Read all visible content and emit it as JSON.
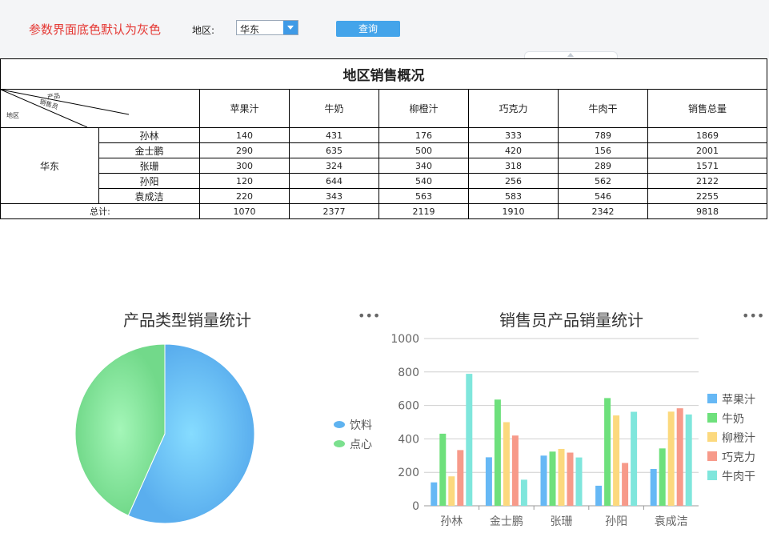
{
  "param_bar": {
    "hint": "参数界面底色默认为灰色",
    "region_label": "地区:",
    "region_value": "华东",
    "query_label": "查询"
  },
  "report": {
    "title": "地区销售概况",
    "corner": {
      "product": "产品",
      "seller": "销售员",
      "region": "地区"
    },
    "columns": [
      "苹果汁",
      "牛奶",
      "柳橙汁",
      "巧克力",
      "牛肉干",
      "销售总量"
    ],
    "region": "华东",
    "rows": [
      {
        "name": "孙林",
        "values": [
          "140",
          "431",
          "176",
          "333",
          "789",
          "1869"
        ]
      },
      {
        "name": "金士鹏",
        "values": [
          "290",
          "635",
          "500",
          "420",
          "156",
          "2001"
        ]
      },
      {
        "name": "张珊",
        "values": [
          "300",
          "324",
          "340",
          "318",
          "289",
          "1571"
        ]
      },
      {
        "name": "孙阳",
        "values": [
          "120",
          "644",
          "540",
          "256",
          "562",
          "2122"
        ]
      },
      {
        "name": "袁成洁",
        "values": [
          "220",
          "343",
          "563",
          "583",
          "546",
          "2255"
        ]
      }
    ],
    "total_label": "总计:",
    "totals": [
      "1070",
      "2377",
      "2119",
      "1910",
      "2342",
      "9818"
    ]
  },
  "chart_data": [
    {
      "type": "pie",
      "title": "产品类型销量统计",
      "slices": [
        {
          "name": "饮料",
          "value": 5566,
          "color": "#5fb3f0"
        },
        {
          "name": "点心",
          "value": 4252,
          "color": "#7be08e"
        }
      ],
      "legend": "right"
    },
    {
      "type": "bar",
      "title": "销售员产品销量统计",
      "categories": [
        "孙林",
        "金士鹏",
        "张珊",
        "孙阳",
        "袁成洁"
      ],
      "series": [
        {
          "name": "苹果汁",
          "values": [
            140,
            290,
            300,
            120,
            220
          ],
          "color": "#66b8f5"
        },
        {
          "name": "牛奶",
          "values": [
            431,
            635,
            324,
            644,
            343
          ],
          "color": "#6ee07c"
        },
        {
          "name": "柳橙汁",
          "values": [
            176,
            500,
            340,
            540,
            563
          ],
          "color": "#fcd97e"
        },
        {
          "name": "巧克力",
          "values": [
            333,
            420,
            318,
            256,
            583
          ],
          "color": "#f79a8a"
        },
        {
          "name": "牛肉干",
          "values": [
            789,
            156,
            289,
            562,
            546
          ],
          "color": "#7fe6dc"
        }
      ],
      "yticks": [
        "0",
        "200",
        "400",
        "600",
        "800",
        "1000"
      ],
      "ylim": [
        0,
        1000
      ],
      "grid": true,
      "legend": "right"
    }
  ],
  "icons": {
    "more": "more-icon",
    "dropdown": "chevron-down-icon"
  },
  "more_glyph": "•••"
}
